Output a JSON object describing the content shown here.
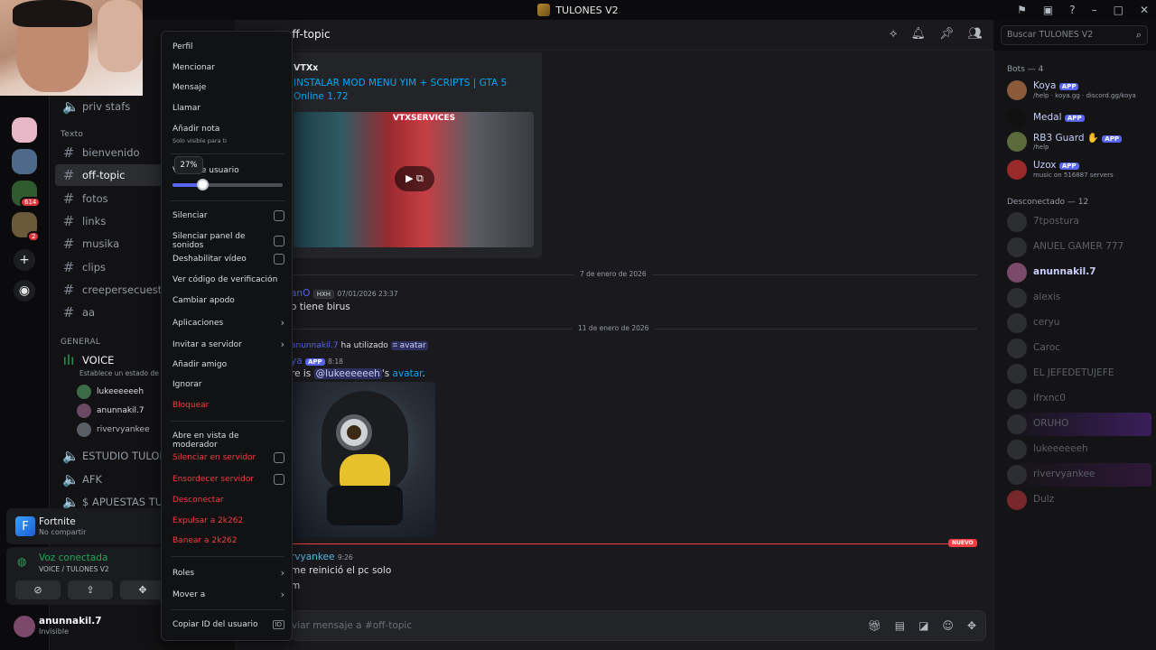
{
  "window": {
    "title": "TULONES V2"
  },
  "channels": {
    "voice_top": "priv stafs",
    "text_category": "Texto",
    "text": [
      "bienvenido",
      "off-topic",
      "fotos",
      "links",
      "musika",
      "clips",
      "creepersecuestrado",
      "aa"
    ],
    "general_category": "GENERAL",
    "voice_channel": "VOICE",
    "voice_status": "Establece un estado de can",
    "voice_users": [
      "lukeeeeeeh",
      "anunnakil.7",
      "rivervyankee"
    ],
    "voice_channels_more": [
      "ESTUDIO TULONES",
      "AFK",
      "$ APUESTAS TULON"
    ]
  },
  "rail": {
    "badge1": "614",
    "badge2": "2"
  },
  "activity": {
    "game": "Fortnite",
    "status": "No compartir"
  },
  "voice_panel": {
    "status": "Voz conectada",
    "location": "VOICE / TULONES V2"
  },
  "user_panel": {
    "name": "anunnakil.7",
    "status": "Invisible"
  },
  "chat": {
    "channel": "off-topic",
    "search_placeholder": "Buscar TULONES V2",
    "embed": {
      "provider": "VTXx",
      "title": "INSTALAR MOD MENU YIM + SCRIPTS | GTA 5 Online 1.72",
      "thumb_text": "VTXSERVICES"
    },
    "dates": [
      "7 de enero de 2026",
      "11 de enero de 2026"
    ],
    "msg1": {
      "author": "anO",
      "tag": "HXH",
      "time": "07/01/2026 23:37",
      "text": "o tiene birus"
    },
    "sys": {
      "user": "anunnakil.7",
      "action": "ha utilizado",
      "command": "avatar"
    },
    "msg2": {
      "author": "ya",
      "badge": "APP",
      "time": "8:18",
      "prefix": "re is",
      "mention": "@lukeeeeeeh",
      "suffix": "'s",
      "link": "avatar",
      "end": "."
    },
    "new_label": "NUEVO",
    "msg3": {
      "author": "rvyankee",
      "time": "9:26",
      "line1": "me reinició el pc solo",
      "line2": "m"
    },
    "composer_placeholder": "viar mensaje a #off-topic"
  },
  "members": {
    "bots_header": "Bots — 4",
    "bots": [
      {
        "name": "Koya",
        "badge": "APP",
        "sub": "/help · koya.gg · discord.gg/koya"
      },
      {
        "name": "Medal",
        "badge": "APP",
        "sub": ""
      },
      {
        "name": "RB3 Guard ✋",
        "badge": "APP",
        "sub": "/help"
      },
      {
        "name": "Uzox",
        "badge": "APP",
        "sub": "music on 516887 servers"
      }
    ],
    "offline_header": "Desconectado — 12",
    "offline": [
      "7tpostura",
      "ANUEL GAMER 777",
      "anunnakil.7",
      "alexis",
      "ceryu",
      "Caroc",
      "EL JEFEDETUJEFE",
      "ifrxnc0",
      "ORUHO",
      "lukeeeeeeh",
      "rivervyankee",
      "Dulz"
    ]
  },
  "context_menu": {
    "items_top": [
      "Perfil",
      "Mencionar",
      "Mensaje",
      "Llamar",
      "Añadir nota"
    ],
    "note_sub": "Solo visible para ti",
    "volume_label": "V       de usuario",
    "volume_tooltip": "27%",
    "volume_percent": 27,
    "checks": [
      "Silenciar",
      "Silenciar panel de sonidos",
      "Deshabilitar vídeo"
    ],
    "verify": "Ver código de verificación",
    "nick": "Cambiar apodo",
    "apps": "Aplicaciones",
    "invite": "Invitar a servidor",
    "add_friend": "Añadir amigo",
    "ignore": "Ignorar",
    "block": "Bloquear",
    "mod_view": "Abre en vista de moderador",
    "server_mute": "Silenciar en servidor",
    "server_deafen": "Ensordecer servidor",
    "disconnect": "Desconectar",
    "kick": "Expulsar a 2k262",
    "ban": "Banear a 2k262",
    "roles": "Roles",
    "move": "Mover a",
    "copy_id": "Copiar ID del usuario",
    "id_badge": "ID"
  },
  "colors": {
    "accent": "#5865f2",
    "danger": "#f23f43",
    "online": "#23a55a",
    "link": "#00a8fc"
  }
}
